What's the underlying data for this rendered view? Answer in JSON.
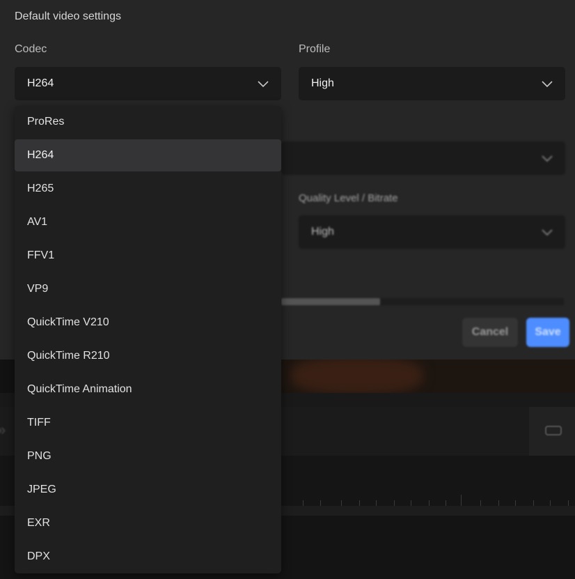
{
  "dialog": {
    "section_title": "Default video settings",
    "codec": {
      "label": "Codec",
      "value": "H264"
    },
    "profile": {
      "label": "Profile",
      "value": "High"
    },
    "quality": {
      "label": "Quality Level / Bitrate",
      "value": "High"
    },
    "cancel_label": "Cancel",
    "save_label": "Save",
    "accent_color": "#4d8dff"
  },
  "codec_dropdown": {
    "selected": "H264",
    "options": [
      "ProRes",
      "H264",
      "H265",
      "AV1",
      "FFV1",
      "VP9",
      "QuickTime V210",
      "QuickTime R210",
      "QuickTime Animation",
      "TIFF",
      "PNG",
      "JPEG",
      "EXR",
      "DPX"
    ]
  },
  "icons": {
    "select_chevron": "chevron-down-icon",
    "transport": "skip-forward-icon",
    "view": "rectangle-icon"
  }
}
